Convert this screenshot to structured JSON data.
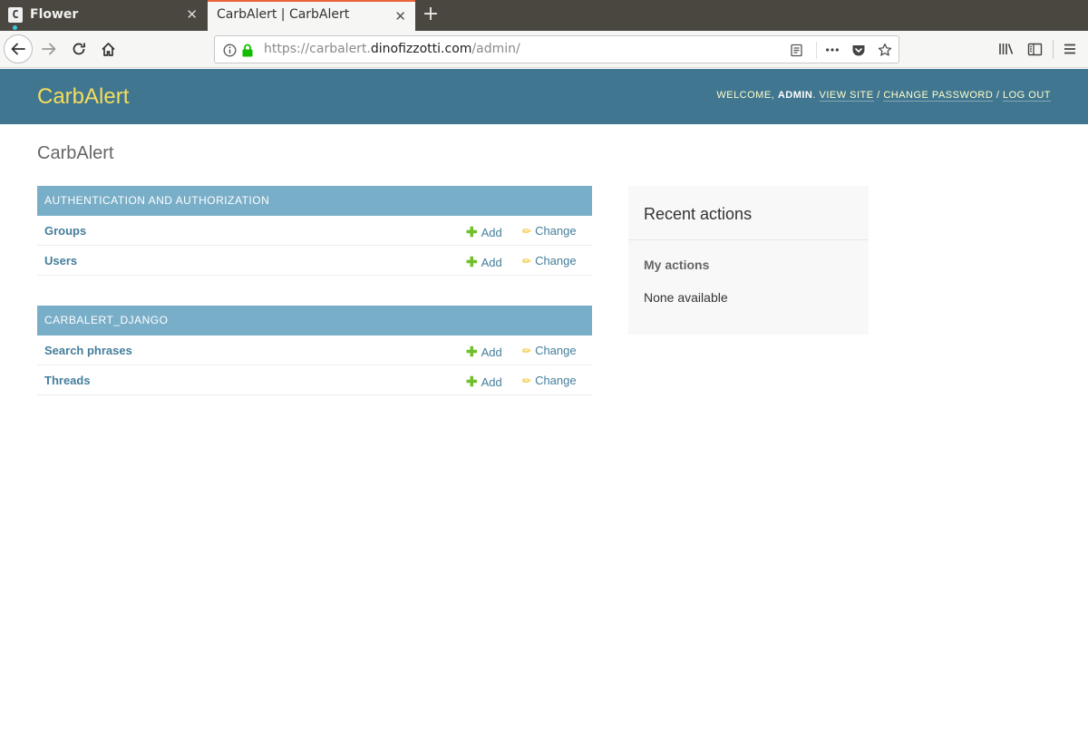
{
  "browser": {
    "tabs": [
      {
        "favicon": "C",
        "title": "Flower",
        "close": "✕"
      },
      {
        "title": "CarbAlert | CarbAlert",
        "close": "✕"
      }
    ],
    "new_tab": "+",
    "url": {
      "prefix": "https://carbalert.",
      "host": "dinofizzotti.com",
      "path": "/admin/"
    }
  },
  "header": {
    "branding": "CarbAlert",
    "welcome": "Welcome,",
    "username": "admin",
    "links": [
      "View site",
      "Change password",
      "Log out"
    ],
    "separator": "/"
  },
  "main": {
    "title": "CarbAlert",
    "modules": [
      {
        "caption": "Authentication and Authorization",
        "models": [
          {
            "name": "Groups",
            "add": "Add",
            "change": "Change"
          },
          {
            "name": "Users",
            "add": "Add",
            "change": "Change"
          }
        ]
      },
      {
        "caption": "Carbalert_Django",
        "models": [
          {
            "name": "Search phrases",
            "add": "Add",
            "change": "Change"
          },
          {
            "name": "Threads",
            "add": "Add",
            "change": "Change"
          }
        ]
      }
    ]
  },
  "sidebar": {
    "title": "Recent actions",
    "subtitle": "My actions",
    "empty": "None available"
  },
  "colors": {
    "header_bg": "#417690",
    "branding": "#f5dd5d",
    "caption_bg": "#79aec8",
    "link": "#447e9b",
    "add_icon": "#70bf2b",
    "change_icon": "#efb80b",
    "tab_accent": "#e8653a"
  },
  "icons": [
    "back-arrow-icon",
    "forward-arrow-icon",
    "reload-icon",
    "home-icon",
    "info-icon",
    "lock-icon",
    "reader-view-icon",
    "more-icon",
    "pocket-icon",
    "bookmark-star-icon",
    "library-icon",
    "sidebar-icon",
    "hamburger-menu-icon"
  ]
}
